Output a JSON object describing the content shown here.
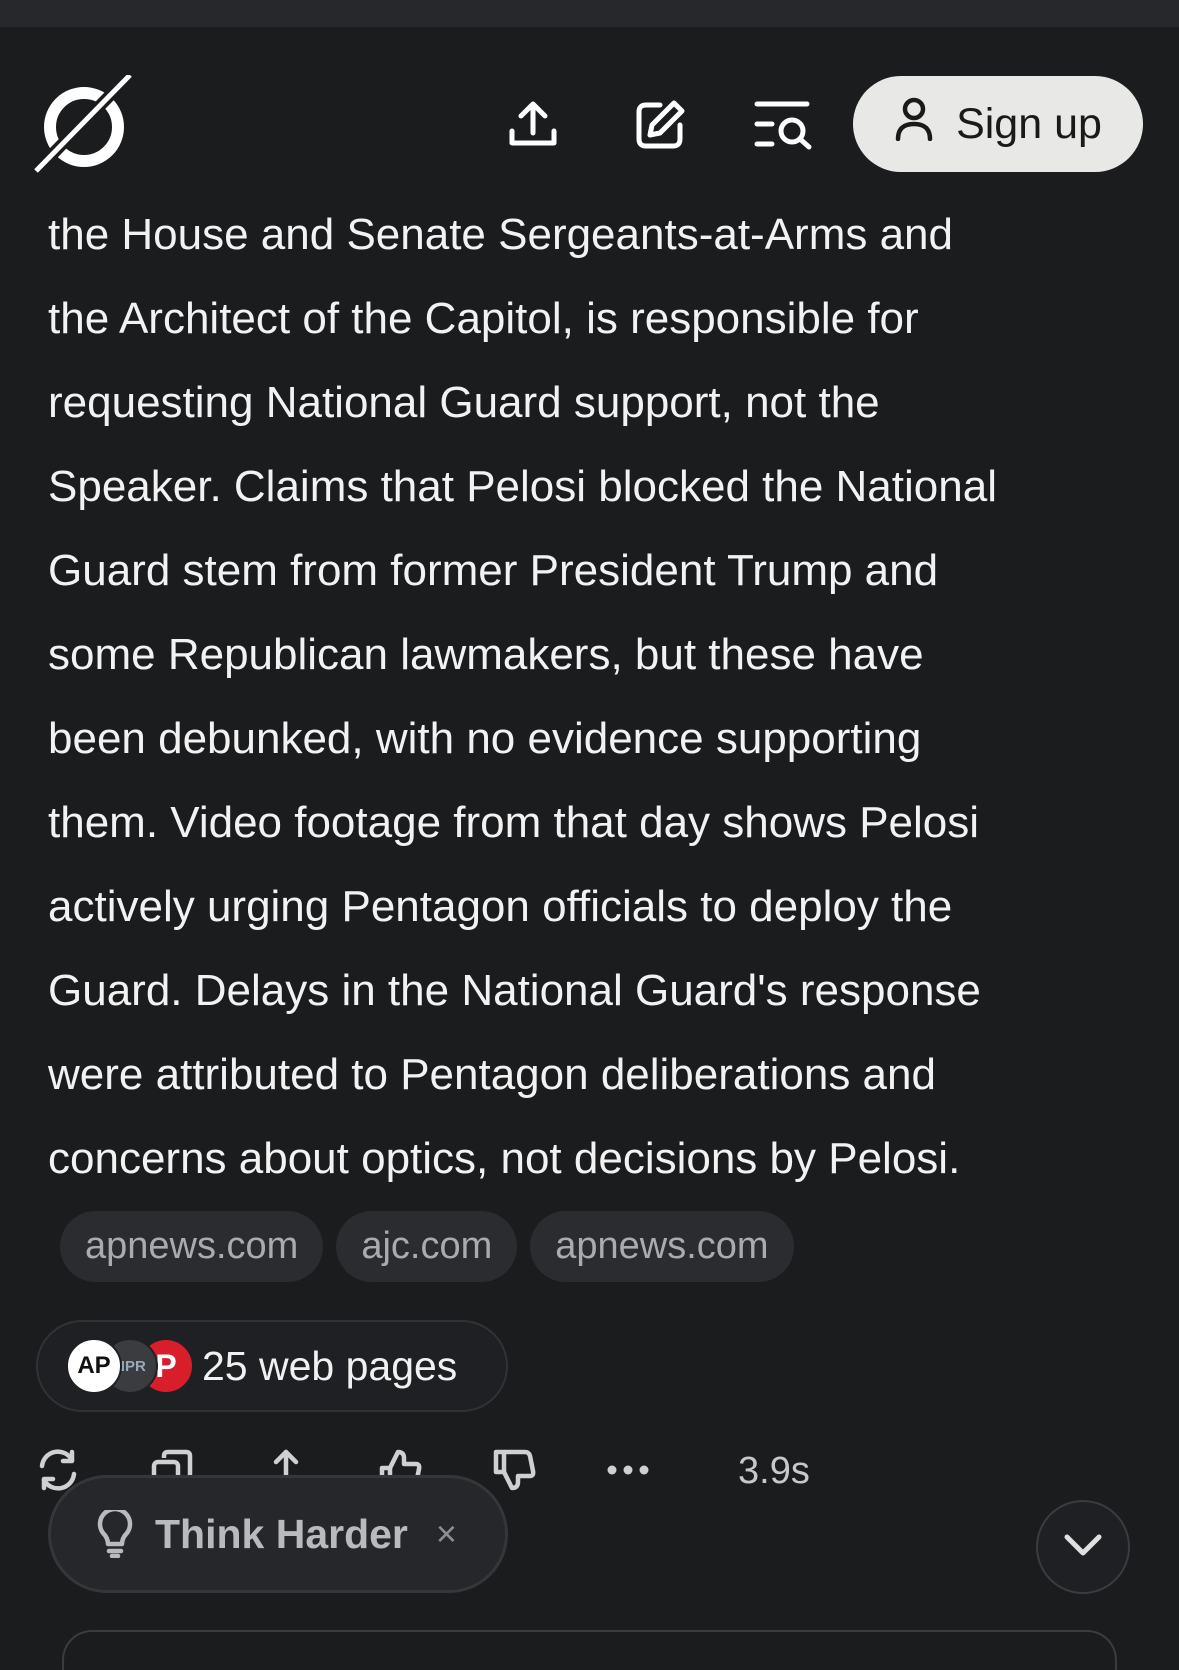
{
  "header": {
    "logo_icon": "grok-logo-icon",
    "share_icon": "upload-share-icon",
    "edit_icon": "compose-edit-icon",
    "history_icon": "search-history-icon",
    "signup_label": "Sign up",
    "signup_icon": "user-icon"
  },
  "answer": {
    "lines": [
      "the House and Senate Sergeants-at-Arms and",
      "the Architect of the Capitol, is responsible for",
      "requesting National Guard support, not the",
      "Speaker. Claims that Pelosi blocked the National",
      "Guard stem from former President Trump and",
      "some Republican lawmakers, but these have",
      "been debunked, with no evidence supporting",
      "them. Video footage from that day shows Pelosi",
      "actively urging Pentagon officials to deploy the",
      "Guard. Delays in the National Guard's response",
      "were attributed to Pentagon deliberations and",
      "concerns about optics, not decisions by Pelosi."
    ]
  },
  "sources": {
    "chips": [
      "apnews.com",
      "ajc.com",
      "apnews.com"
    ],
    "web_pages_label": "25 web pages",
    "favicons": [
      "AP",
      "NPR",
      "P"
    ]
  },
  "actions": {
    "icons": [
      "regenerate-icon",
      "copy-icon",
      "share-icon",
      "thumbs-up-icon",
      "thumbs-down-icon",
      "more-icon"
    ],
    "timing": "3.9s"
  },
  "think_harder": {
    "label": "Think Harder",
    "close": "×"
  },
  "colors": {
    "background": "#1b1c1e",
    "signup_bg": "#e8e8e6",
    "chip_bg": "#2a2c2f"
  }
}
